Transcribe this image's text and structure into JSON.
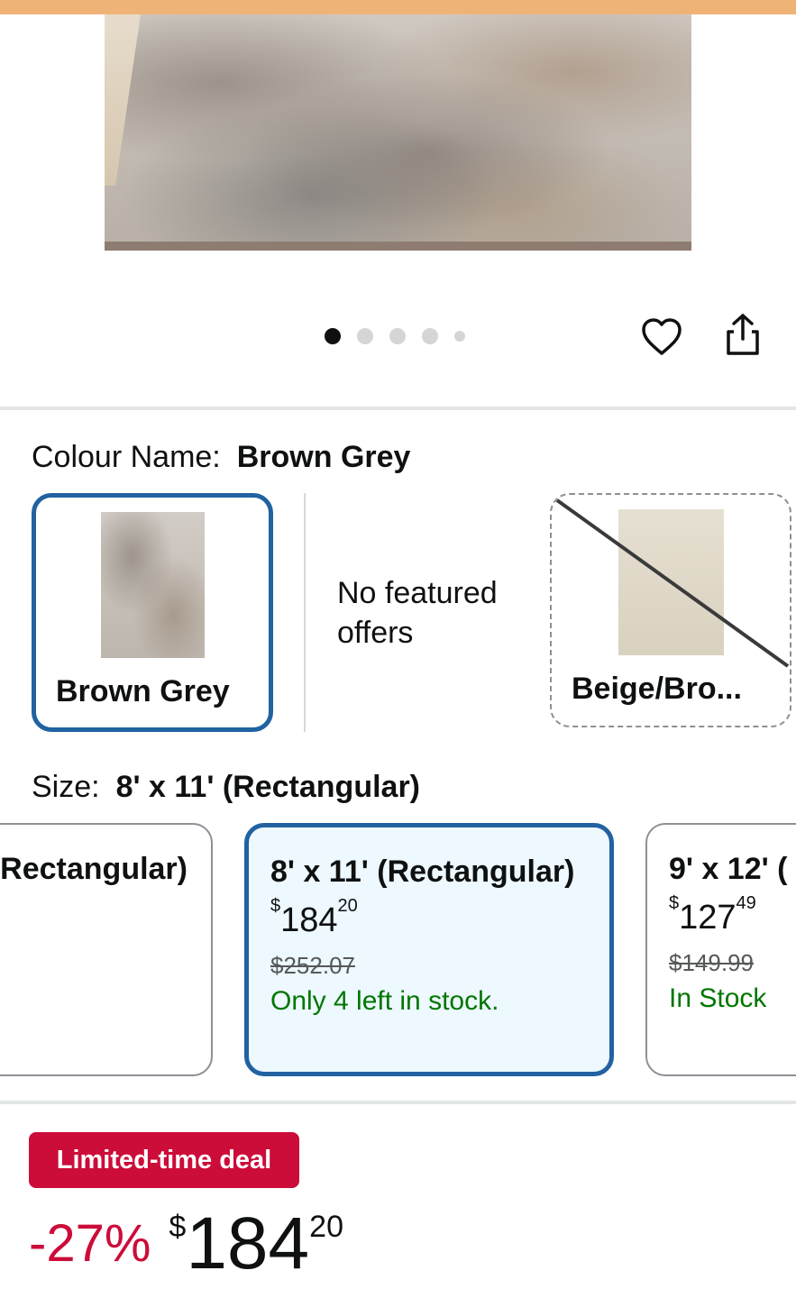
{
  "gallery": {
    "active_index": 0,
    "dot_count": 5
  },
  "colour": {
    "label": "Colour Name:",
    "selected": "Brown Grey",
    "options": [
      {
        "name": "Brown Grey",
        "state": "selected"
      },
      {
        "name": "Beige/Bro...",
        "state": "unavailable"
      }
    ],
    "no_offers_text": "No featured offers"
  },
  "size": {
    "label": "Size:",
    "selected": "8' x 11' (Rectangular)",
    "options": [
      {
        "title": "Rectangular)"
      },
      {
        "title": "8' x 11' (Rectangular)",
        "currency": "$",
        "whole": "184",
        "fraction": "20",
        "was": "$252.07",
        "stock": "Only 4 left in stock."
      },
      {
        "title": "9' x 12' (",
        "currency": "$",
        "whole": "127",
        "fraction": "49",
        "was": "$149.99",
        "stock": "In Stock"
      }
    ]
  },
  "deal": {
    "badge": "Limited-time deal",
    "discount": "-27%",
    "currency": "$",
    "whole": "184",
    "fraction": "20"
  },
  "colors": {
    "accent_blue": "#2162a1",
    "deal_red": "#cc0c39",
    "stock_green": "#007600",
    "top_strip": "#f0b377"
  },
  "icons": [
    "heart-icon",
    "share-icon"
  ]
}
